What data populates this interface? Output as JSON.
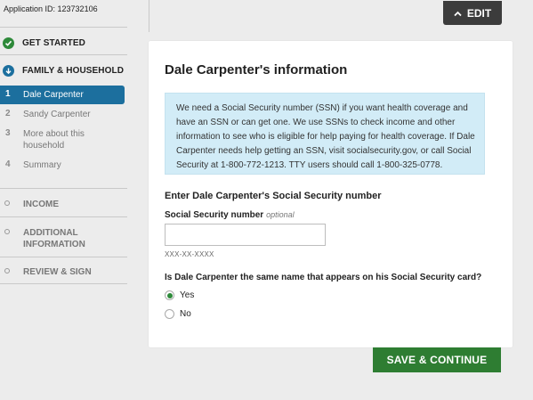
{
  "application_id": "Application ID: 123732106",
  "edit_button": {
    "label": "EDIT",
    "icon": "chevron-up-icon"
  },
  "sidebar": {
    "sections": [
      {
        "label": "GET STARTED",
        "status": "complete",
        "icon": "check-circle-icon"
      },
      {
        "label": "FAMILY & HOUSEHOLD",
        "status": "current",
        "icon": "arrow-down-circle-icon",
        "items": [
          {
            "num": "1",
            "label": "Dale Carpenter",
            "active": true
          },
          {
            "num": "2",
            "label": "Sandy Carpenter"
          },
          {
            "num": "3",
            "label": "More about this household"
          },
          {
            "num": "4",
            "label": "Summary"
          }
        ]
      },
      {
        "label": "INCOME"
      },
      {
        "label": "ADDITIONAL INFORMATION"
      },
      {
        "label": "REVIEW & SIGN"
      }
    ]
  },
  "main": {
    "title": "Dale Carpenter's information",
    "info": "We need a Social Security number (SSN) if you want health coverage and have an SSN or can get one. We use SSNs to check income and other information to see who is eligible for help paying for health coverage. If Dale Carpenter needs help getting an SSN, visit socialsecurity.gov, or call Social Security at 1-800-772-1213. TTY users should call 1-800-325-0778.",
    "ssn_heading": "Enter Dale Carpenter's Social Security number",
    "ssn_label": "Social Security number",
    "ssn_optional": "optional",
    "ssn_value": "",
    "ssn_format": "XXX-XX-XXXX",
    "question": "Is Dale Carpenter the same name that appears on his Social Security card?",
    "options": [
      {
        "label": "Yes",
        "selected": true
      },
      {
        "label": "No",
        "selected": false
      }
    ],
    "save_button": "SAVE & CONTINUE"
  },
  "colors": {
    "accent_blue": "#1c6f9e",
    "accent_green": "#2e7d32",
    "info_bg": "#d2ecf7"
  }
}
